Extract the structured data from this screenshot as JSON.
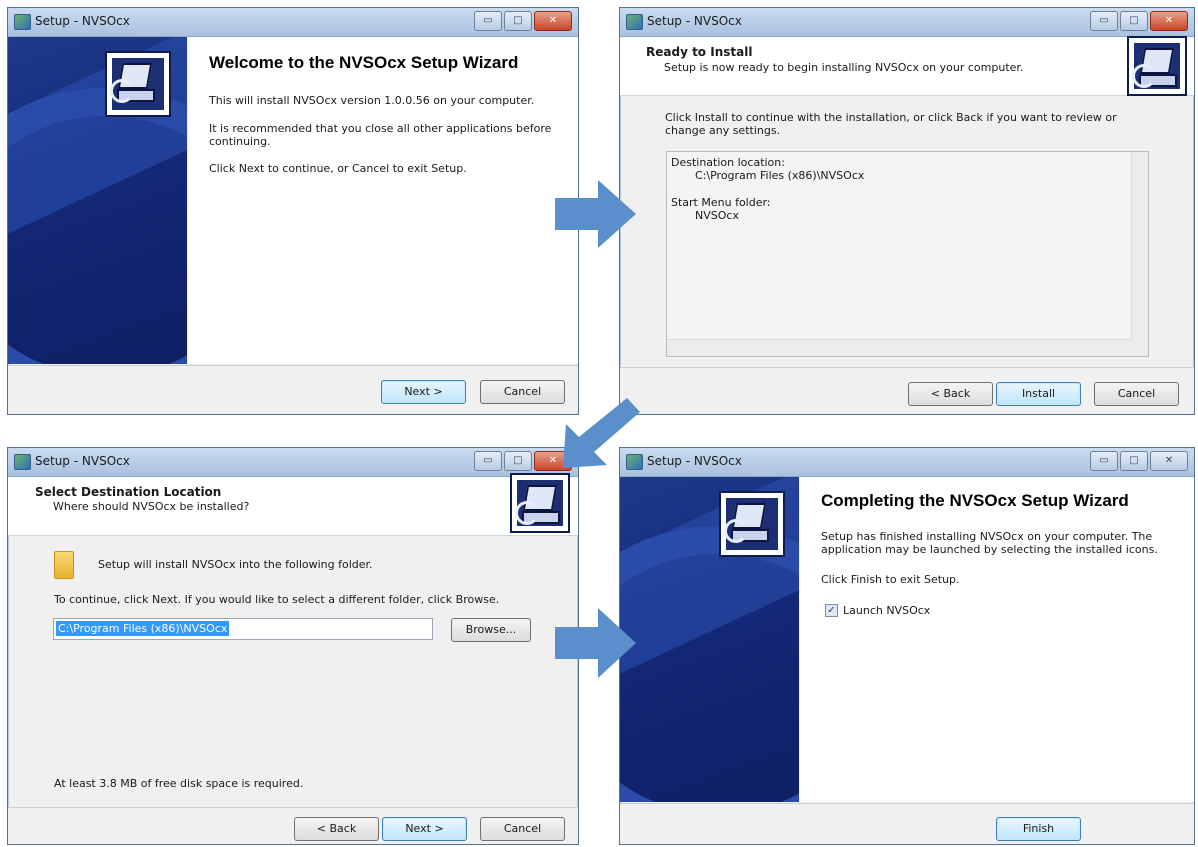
{
  "common": {
    "window_title": "Setup - NVSOcx",
    "minimize_glyph": "▭",
    "maximize_glyph": "□",
    "close_glyph": "✕",
    "close_glyph_inactive": "✕"
  },
  "welcome": {
    "heading": "Welcome to the NVSOcx Setup Wizard",
    "line1": "This will install NVSOcx version 1.0.0.56 on your computer.",
    "line2": "It is recommended that you close all other applications before continuing.",
    "line3": "Click Next to continue, or Cancel to exit Setup.",
    "next_label": "Next >",
    "cancel_label": "Cancel"
  },
  "ready": {
    "header_title": "Ready to Install",
    "header_subtitle": "Setup is now ready to begin installing NVSOcx on your computer.",
    "instruction": "Click Install to continue with the installation, or click Back if you want to review or change any settings.",
    "dest_label": "Destination location:",
    "dest_value": "C:\\Program Files (x86)\\NVSOcx",
    "menu_label": "Start Menu folder:",
    "menu_value": "NVSOcx",
    "back_label": "< Back",
    "install_label": "Install",
    "cancel_label": "Cancel"
  },
  "destination": {
    "header_title": "Select Destination Location",
    "header_subtitle": "Where should NVSOcx be installed?",
    "folder_text": "Setup will install NVSOcx into the following folder.",
    "instruction": "To continue, click Next. If you would like to select a different folder, click Browse.",
    "path_value": "C:\\Program Files (x86)\\NVSOcx",
    "browse_label": "Browse...",
    "disk_space": "At least 3.8 MB of free disk space is required.",
    "back_label": "< Back",
    "next_label": "Next >",
    "cancel_label": "Cancel"
  },
  "completing": {
    "heading": "Completing the NVSOcx Setup Wizard",
    "line1": "Setup has finished installing NVSOcx on your computer. The application may be launched by selecting the installed icons.",
    "line2": "Click Finish to exit Setup.",
    "launch_label": "Launch NVSOcx",
    "launch_checked": true,
    "finish_label": "Finish"
  },
  "colors": {
    "arrow": "#5b8fcb",
    "sidebar": "#1f3a8a"
  }
}
